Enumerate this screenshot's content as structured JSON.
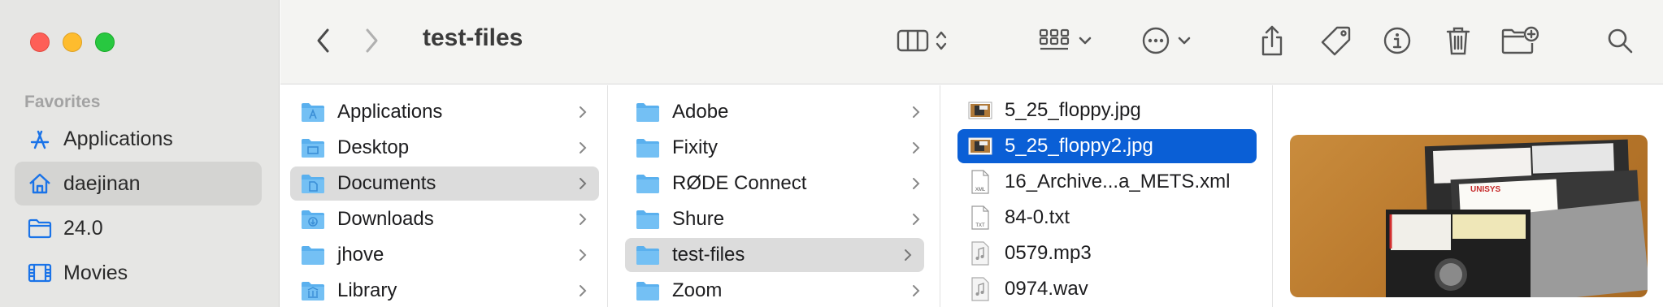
{
  "window": {
    "title": "test-files"
  },
  "sidebar": {
    "section_label": "Favorites",
    "items": [
      {
        "label": "Applications",
        "icon": "applications-icon",
        "selected": false
      },
      {
        "label": "daejinan",
        "icon": "home-icon",
        "selected": true
      },
      {
        "label": "24.0",
        "icon": "folder-icon",
        "selected": false
      },
      {
        "label": "Movies",
        "icon": "film-icon",
        "selected": false
      }
    ]
  },
  "toolbar": {
    "back_icon": "chevron-left-icon",
    "forward_icon": "chevron-right-icon",
    "view_icon": "column-view-icon",
    "group_icon": "grid-icon",
    "more_icon": "ellipsis-circle-icon",
    "share_icon": "share-icon",
    "tag_icon": "tag-icon",
    "info_icon": "info-icon",
    "trash_icon": "trash-icon",
    "new_folder_icon": "new-folder-icon",
    "search_icon": "search-icon"
  },
  "columns": {
    "col1": [
      {
        "name": "Applications",
        "selected": false
      },
      {
        "name": "Desktop",
        "selected": false
      },
      {
        "name": "Documents",
        "selected": true
      },
      {
        "name": "Downloads",
        "selected": false
      },
      {
        "name": "jhove",
        "selected": false
      },
      {
        "name": "Library",
        "selected": false
      }
    ],
    "col2": [
      {
        "name": "Adobe",
        "selected": false
      },
      {
        "name": "Fixity",
        "selected": false
      },
      {
        "name": "RØDE Connect",
        "selected": false
      },
      {
        "name": "Shure",
        "selected": false
      },
      {
        "name": "test-files",
        "selected": true
      },
      {
        "name": "Zoom",
        "selected": false
      }
    ],
    "col3": [
      {
        "name": "5_25_floppy.jpg",
        "type": "image",
        "selected": false
      },
      {
        "name": "5_25_floppy2.jpg",
        "type": "image",
        "selected": true
      },
      {
        "name": "16_Archive...a_METS.xml",
        "type": "xml",
        "selected": false
      },
      {
        "name": "84-0.txt",
        "type": "txt",
        "selected": false
      },
      {
        "name": "0579.mp3",
        "type": "audio",
        "selected": false
      },
      {
        "name": "0974.wav",
        "type": "audio",
        "selected": false
      }
    ]
  },
  "file_badges": {
    "xml": "XML",
    "txt": "TXT"
  },
  "preview": {
    "label_brand": "UNISYS"
  },
  "colors": {
    "selection_blue": "#0a5fd6",
    "selection_grey": "#dcdcdc",
    "folder_blue": "#5ab0ee",
    "sidebar_accent": "#1a73e8"
  }
}
